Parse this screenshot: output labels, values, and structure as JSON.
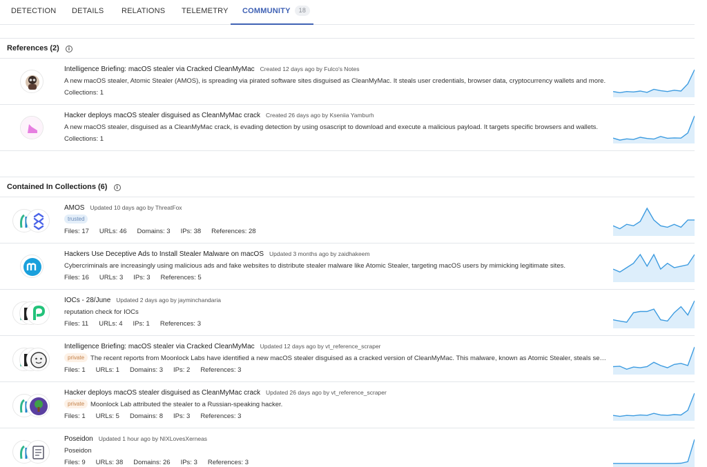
{
  "tabs": [
    {
      "label": "DETECTION"
    },
    {
      "label": "DETAILS"
    },
    {
      "label": "RELATIONS"
    },
    {
      "label": "TELEMETRY"
    },
    {
      "label": "COMMUNITY",
      "count": "18",
      "active": true
    }
  ],
  "references": {
    "header": "References",
    "count": "(2)",
    "items": [
      {
        "title": "Intelligence Briefing: macOS stealer via Cracked CleanMyMac",
        "meta": "Created 12 days ago by Fulco's Notes",
        "description": "A new macOS stealer, Atomic Stealer (AMOS), is spreading via pirated software sites disguised as CleanMyMac. It steals user credentials, browser data, cryptocurrency wallets and more.",
        "collections": "Collections: 1",
        "spark": [
          2,
          1.5,
          2,
          1.8,
          2.2,
          1.6,
          3,
          2.4,
          2,
          2.6,
          2.2,
          5.5,
          12
        ]
      },
      {
        "title": "Hacker deploys macOS stealer disguised as CleanMyMac crack",
        "meta": "Created 26 days ago by Kseniia Yamburh",
        "description": "A new macOS stealer, disguised as a CleanMyMac crack, is evading detection by using osascript to download and execute a malicious payload. It targets specific browsers and wallets.",
        "collections": "Collections: 1",
        "spark": [
          2,
          1,
          1.6,
          1.3,
          2.4,
          1.8,
          1.5,
          2.8,
          1.9,
          2.1,
          2,
          4.5,
          13
        ]
      }
    ]
  },
  "collections": {
    "header": "Contained In Collections",
    "count": "(6)",
    "items": [
      {
        "title": "AMOS",
        "meta": "Updated 10 days ago by ThreatFox",
        "badge": "trusted",
        "description": "",
        "stats": [
          "Files: 17",
          "URLs: 46",
          "Domains: 3",
          "IPs: 38",
          "References: 28"
        ],
        "spark": [
          3,
          2,
          3.5,
          3,
          4.5,
          9,
          5,
          3,
          2.5,
          3.5,
          2.5,
          5,
          5
        ]
      },
      {
        "title": "Hackers Use Deceptive Ads to Install Stealer Malware on macOS",
        "meta": "Updated 3 months ago by zaidhakeem",
        "badge": "",
        "description": "Cybercriminals are increasingly using malicious ads and fake websites to distribute stealer malware like Atomic Stealer, targeting macOS users by mimicking legitimate sites.",
        "stats": [
          "Files: 16",
          "URLs: 3",
          "IPs: 3",
          "References: 5"
        ],
        "spark": [
          4,
          3,
          4.5,
          6,
          9,
          5,
          9,
          4,
          6,
          4.5,
          5,
          5.5,
          9
        ]
      },
      {
        "title": "IOCs - 28/June",
        "meta": "Updated 2 days ago by jayminchandaria",
        "badge": "",
        "description": "reputation check for IOCs",
        "stats": [
          "Files: 11",
          "URLs: 4",
          "IPs: 1",
          "References: 3"
        ],
        "spark": [
          3,
          2.5,
          2,
          6,
          6.5,
          6.5,
          7.5,
          3,
          2.5,
          6,
          8.5,
          5,
          11
        ]
      },
      {
        "title": "Intelligence Briefing: macOS stealer via Cracked CleanMyMac",
        "meta": "Updated 12 days ago by vt_reference_scraper",
        "badge": "private",
        "description": "The recent reports from Moonlock Labs have identified a new macOS stealer disguised as a cracked version of CleanMyMac. This malware, known as Atomic Stealer, steals sensitive data.",
        "stats": [
          "Files: 1",
          "URLs: 1",
          "Domains: 3",
          "IPs: 2",
          "References: 3"
        ],
        "spark": [
          3,
          3.2,
          1.8,
          2.8,
          2.5,
          3,
          5,
          3.5,
          2.5,
          4,
          4.5,
          3.5,
          12
        ]
      },
      {
        "title": "Hacker deploys macOS stealer disguised as CleanMyMac crack",
        "meta": "Updated 26 days ago by vt_reference_scraper",
        "badge": "private",
        "description": "Moonlock Lab attributed the stealer to a Russian-speaking hacker.",
        "stats": [
          "Files: 1",
          "URLs: 5",
          "Domains: 8",
          "IPs: 3",
          "References: 3"
        ],
        "spark": [
          2,
          1.5,
          2,
          1.8,
          2.2,
          2,
          3,
          2.2,
          2,
          2.4,
          2.2,
          4.5,
          13
        ]
      },
      {
        "title": "Poseidon",
        "meta": "Updated 1 hour ago by NIXLovesXerneas",
        "badge": "",
        "description": "Poseidon",
        "stats": [
          "Files: 9",
          "URLs: 38",
          "Domains: 26",
          "IPs: 3",
          "References: 3"
        ],
        "spark": [
          1,
          1,
          1,
          1,
          1,
          1,
          1,
          1,
          1,
          1,
          1.1,
          1.8,
          12
        ]
      }
    ]
  },
  "colors": {
    "accent": "#3f61b4",
    "spark_line": "#3c9be0",
    "spark_fill": "#ddeefb"
  }
}
